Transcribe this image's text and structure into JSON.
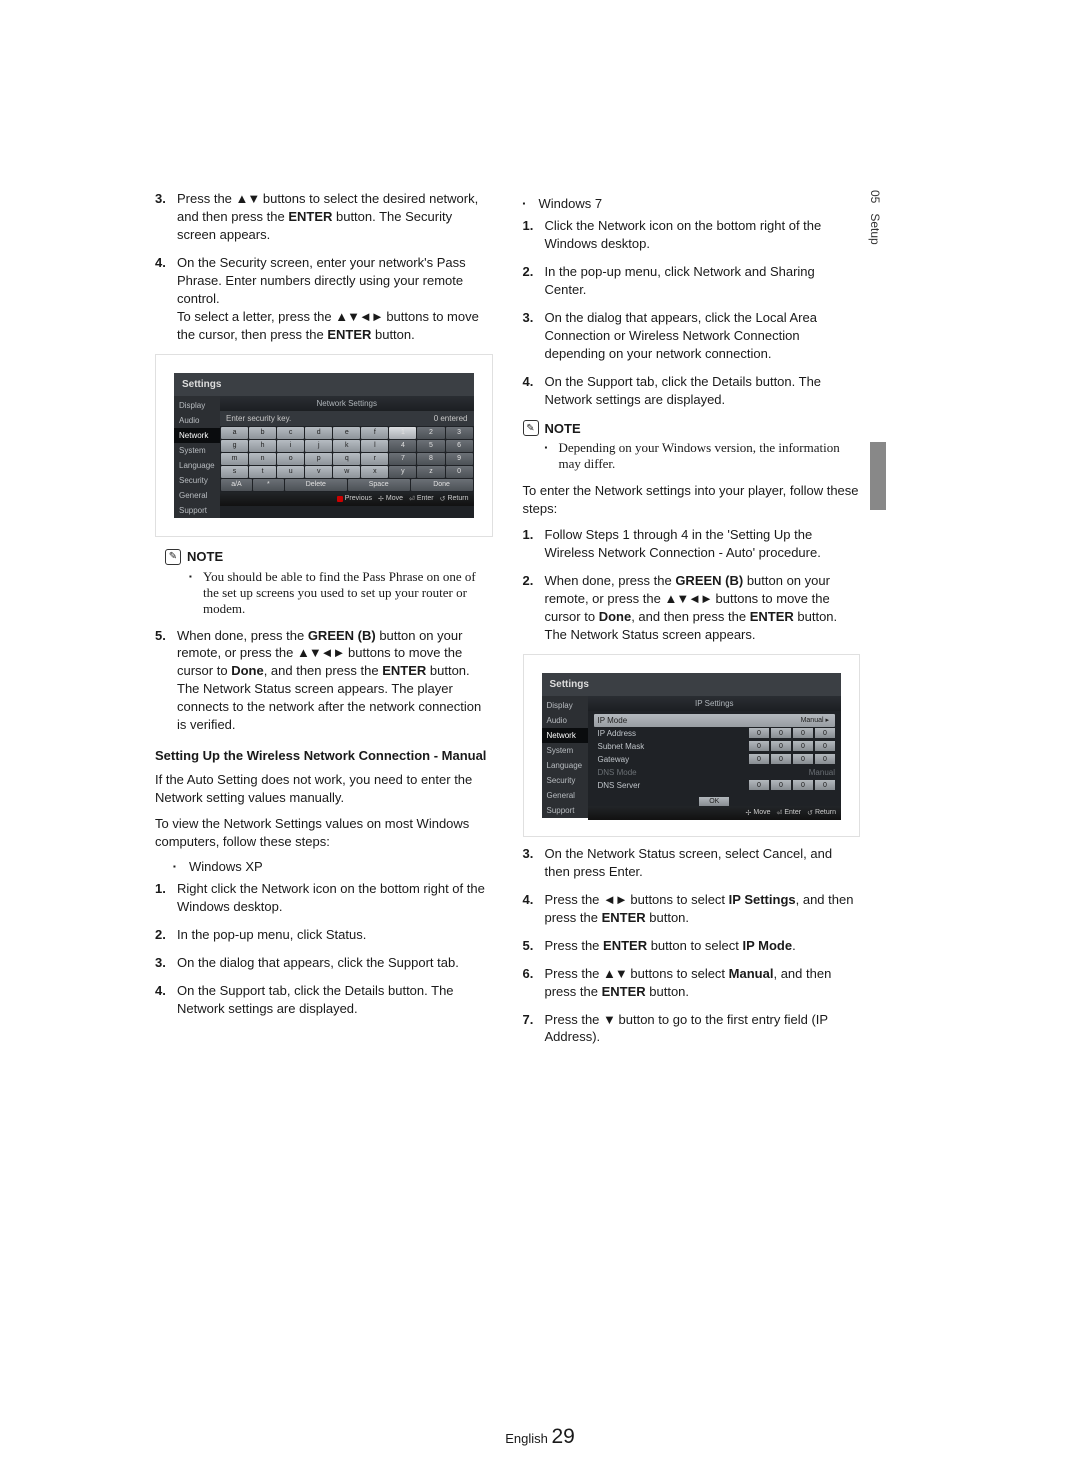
{
  "margin": {
    "section": "05",
    "label": "Setup"
  },
  "ghost_header": "",
  "left": {
    "steps_a": [
      {
        "n": "3.",
        "p": [
          {
            "t": "Press the "
          },
          {
            "t": "▲▼",
            "cls": "arrows"
          },
          {
            "t": " buttons to select the desired network, and then press the "
          },
          {
            "t": "ENTER",
            "b": true
          },
          {
            "t": " button. The Security screen appears."
          }
        ]
      },
      {
        "n": "4.",
        "p": [
          {
            "t": "On the Security screen, enter your network's Pass Phrase. Enter numbers directly using your remote control.\nTo select a letter, press the "
          },
          {
            "t": "▲▼◄►",
            "cls": "arrows"
          },
          {
            "t": " buttons to move the cursor, then press the "
          },
          {
            "t": "ENTER",
            "b": true
          },
          {
            "t": " button."
          }
        ]
      }
    ],
    "ui1": {
      "title": "Settings",
      "menu": [
        "Display",
        "Audio",
        "Network",
        "System",
        "Language",
        "Security",
        "General",
        "Support"
      ],
      "active": 2,
      "panel_title": "Network Settings",
      "prompt": "Enter security key.",
      "count": "0 entered",
      "rows": [
        [
          "a",
          "b",
          "c",
          "d",
          "e",
          "f",
          "1",
          "2",
          "3"
        ],
        [
          "g",
          "h",
          "i",
          "j",
          "k",
          "l",
          "4",
          "5",
          "6"
        ],
        [
          "m",
          "n",
          "o",
          "p",
          "q",
          "r",
          "7",
          "8",
          "9"
        ],
        [
          "s",
          "t",
          "u",
          "v",
          "w",
          "x",
          "y",
          "z",
          "0"
        ]
      ],
      "bottom": [
        "a/A",
        "*",
        "Delete",
        "Space",
        "Done"
      ],
      "footer": [
        {
          "ic": "red",
          "t": "Previous"
        },
        {
          "ic": "move",
          "t": "Move"
        },
        {
          "ic": "enter",
          "t": "Enter"
        },
        {
          "ic": "return",
          "t": "Return"
        }
      ]
    },
    "note1": {
      "label": "NOTE",
      "items": [
        "You should be able to find the Pass Phrase on one of the set up screens you used to set up your router or modem."
      ]
    },
    "steps_b": [
      {
        "n": "5.",
        "p": [
          {
            "t": "When done, press the "
          },
          {
            "t": "GREEN (B)",
            "b": true
          },
          {
            "t": " button on your remote, or press the "
          },
          {
            "t": "▲▼◄►",
            "cls": "arrows"
          },
          {
            "t": " buttons to move the cursor to "
          },
          {
            "t": "Done",
            "b": true
          },
          {
            "t": ", and then press the "
          },
          {
            "t": "ENTER",
            "b": true
          },
          {
            "t": " button.\nThe Network Status screen appears. The player connects to the network after the network connection is verified."
          }
        ]
      }
    ],
    "subhead": "Setting Up the Wireless Network Connection - Manual",
    "para1": "If the Auto Setting does not work, you need to enter the Network setting values manually.",
    "para2": "To view the Network Settings values on most Windows computers, follow these steps:",
    "winxp_label": "Windows XP",
    "winxp_steps": [
      {
        "n": "1.",
        "t": "Right click the Network icon on the bottom right of the Windows desktop."
      },
      {
        "n": "2.",
        "t": "In the pop-up menu, click Status."
      },
      {
        "n": "3.",
        "t": "On the dialog that appears, click the Support tab."
      },
      {
        "n": "4.",
        "t": "On the Support tab, click the Details button. The Network settings are displayed."
      }
    ]
  },
  "right": {
    "win7_label": "Windows 7",
    "win7_steps": [
      {
        "n": "1.",
        "t": "Click the Network icon on the bottom right of the Windows desktop."
      },
      {
        "n": "2.",
        "t": "In the pop-up menu, click Network and Sharing Center."
      },
      {
        "n": "3.",
        "t": "On the dialog that appears, click the Local Area Connection or Wireless Network Connection depending on your network connection."
      },
      {
        "n": "4.",
        "t": "On the Support tab, click the Details button. The Network settings are displayed."
      }
    ],
    "note2": {
      "label": "NOTE",
      "items": [
        "Depending on your Windows version, the information may differ."
      ]
    },
    "para3": "To enter the Network settings into your player, follow these steps:",
    "steps_c": [
      {
        "n": "1.",
        "p": [
          {
            "t": "Follow Steps 1 through 4 in the 'Setting Up the Wireless Network Connection - Auto' procedure."
          }
        ]
      },
      {
        "n": "2.",
        "p": [
          {
            "t": "When done, press the "
          },
          {
            "t": "GREEN (B)",
            "b": true
          },
          {
            "t": " button on your remote, or press the "
          },
          {
            "t": "▲▼◄►",
            "cls": "arrows"
          },
          {
            "t": " buttons to move the cursor to "
          },
          {
            "t": "Done",
            "b": true
          },
          {
            "t": ", and then press the "
          },
          {
            "t": "ENTER",
            "b": true
          },
          {
            "t": " button. The Network Status screen appears."
          }
        ]
      }
    ],
    "ui2": {
      "title": "Settings",
      "menu": [
        "Display",
        "Audio",
        "Network",
        "System",
        "Language",
        "Security",
        "General",
        "Support"
      ],
      "active": 2,
      "panel_title": "IP Settings",
      "rows": [
        {
          "lbl": "IP Mode",
          "type": "select",
          "val": "Manual"
        },
        {
          "lbl": "IP Address",
          "type": "oct",
          "val": [
            "0",
            "0",
            "0",
            "0"
          ]
        },
        {
          "lbl": "Subnet Mask",
          "type": "oct",
          "val": [
            "0",
            "0",
            "0",
            "0"
          ]
        },
        {
          "lbl": "Gateway",
          "type": "oct",
          "val": [
            "0",
            "0",
            "0",
            "0"
          ]
        },
        {
          "lbl": "DNS Mode",
          "type": "dim",
          "val": "Manual"
        },
        {
          "lbl": "DNS Server",
          "type": "oct",
          "val": [
            "0",
            "0",
            "0",
            "0"
          ]
        }
      ],
      "ok": "OK",
      "footer": [
        {
          "ic": "move",
          "t": "Move"
        },
        {
          "ic": "enter",
          "t": "Enter"
        },
        {
          "ic": "return",
          "t": "Return"
        }
      ]
    },
    "steps_d": [
      {
        "n": "3.",
        "p": [
          {
            "t": "On the Network Status screen, select Cancel, and then press Enter."
          }
        ]
      },
      {
        "n": "4.",
        "p": [
          {
            "t": "Press the "
          },
          {
            "t": "◄►",
            "cls": "arrows"
          },
          {
            "t": " buttons to select "
          },
          {
            "t": "IP Settings",
            "b": true
          },
          {
            "t": ", and then press the "
          },
          {
            "t": "ENTER",
            "b": true
          },
          {
            "t": " button."
          }
        ]
      },
      {
        "n": "5.",
        "p": [
          {
            "t": "Press the "
          },
          {
            "t": "ENTER",
            "b": true
          },
          {
            "t": " button to select "
          },
          {
            "t": "IP Mode",
            "b": true
          },
          {
            "t": "."
          }
        ]
      },
      {
        "n": "6.",
        "p": [
          {
            "t": "Press the "
          },
          {
            "t": "▲▼",
            "cls": "arrows"
          },
          {
            "t": " buttons to select "
          },
          {
            "t": "Manual",
            "b": true
          },
          {
            "t": ", and then press the "
          },
          {
            "t": "ENTER",
            "b": true
          },
          {
            "t": " button."
          }
        ]
      },
      {
        "n": "7.",
        "p": [
          {
            "t": "Press the "
          },
          {
            "t": "▼",
            "cls": "arrows"
          },
          {
            "t": " button to go to the first entry field (IP Address)."
          }
        ]
      }
    ]
  },
  "footer": {
    "lang": "English",
    "page": "29"
  }
}
